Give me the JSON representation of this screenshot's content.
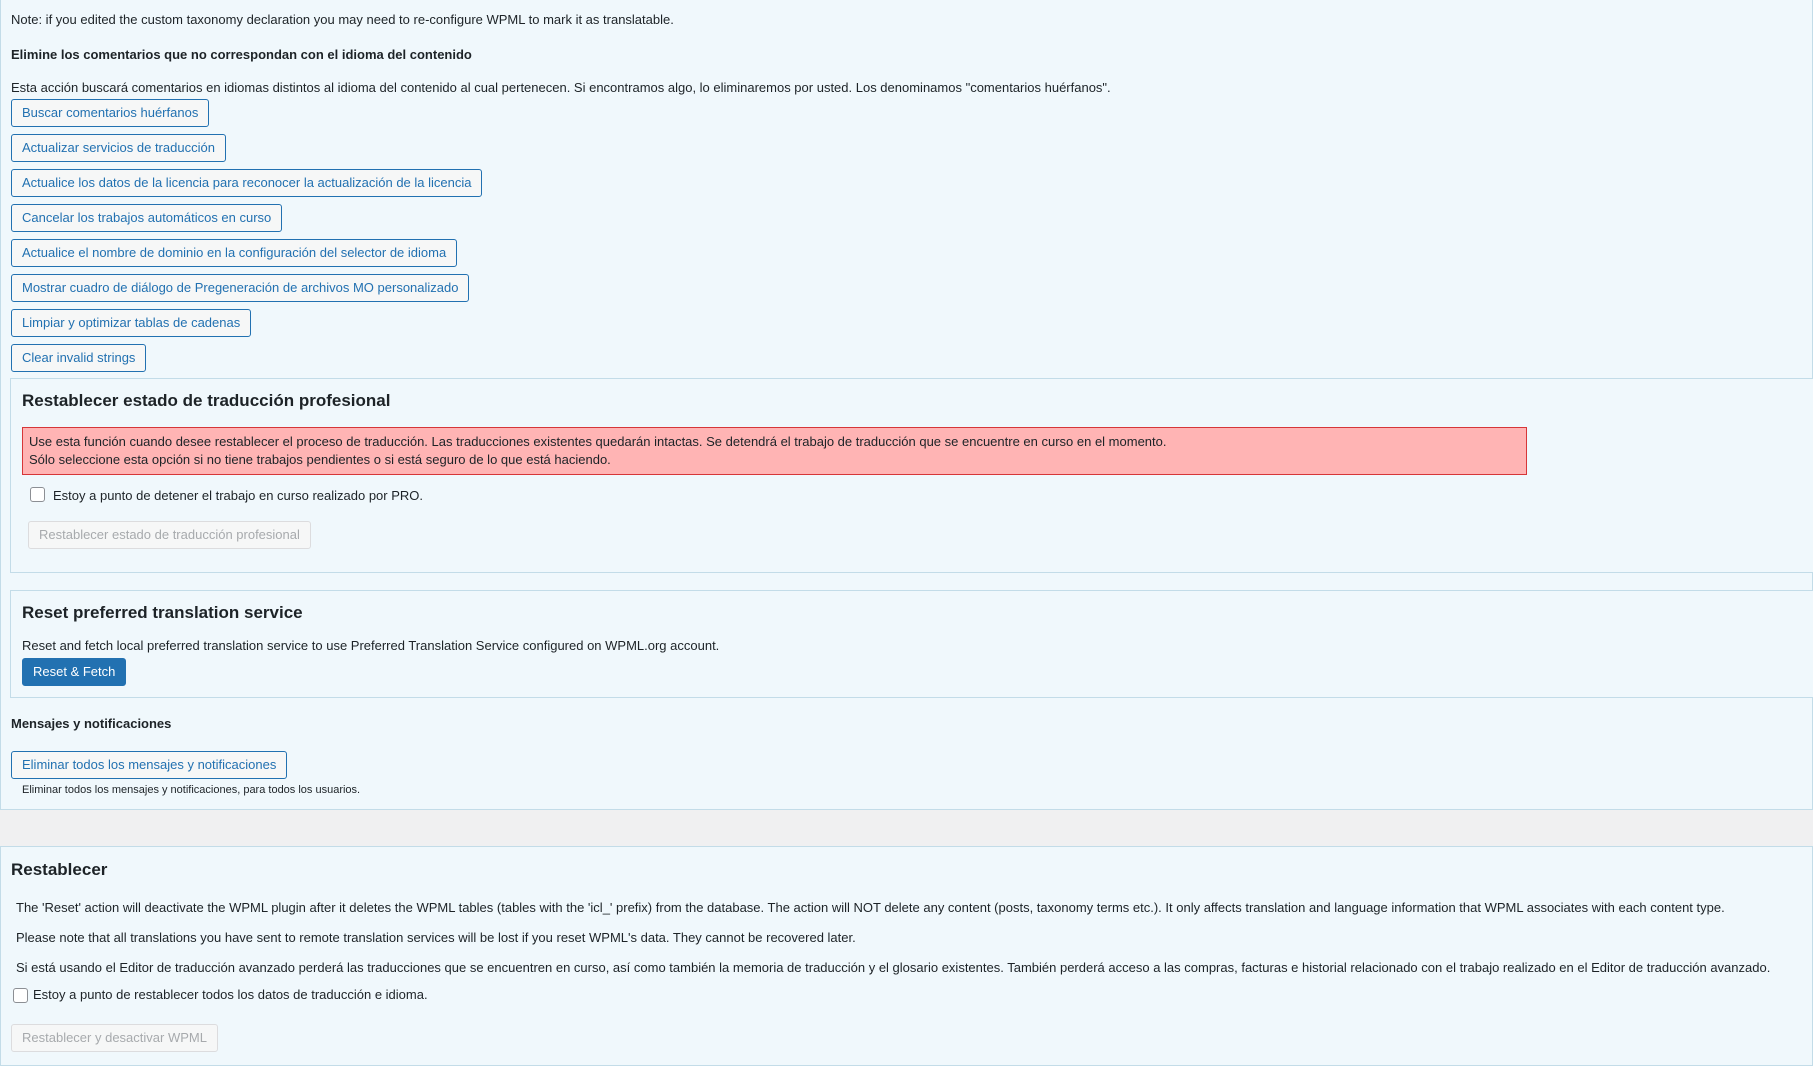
{
  "note": "Note: if you edited the custom taxonomy declaration you may need to re-configure WPML to mark it as translatable.",
  "orphans": {
    "heading": "Elimine los comentarios que no correspondan con el idioma del contenido",
    "description": "Esta acción buscará comentarios en idiomas distintos al idioma del contenido al cual pertenecen. Si encontramos algo, lo eliminaremos por usted. Los denominamos \"comentarios huérfanos\"."
  },
  "buttons": {
    "find_orphans": "Buscar comentarios huérfanos",
    "update_services": "Actualizar servicios de traducción",
    "update_license": "Actualice los datos de la licencia para reconocer la actualización de la licencia",
    "cancel_jobs": "Cancelar los trabajos automáticos en curso",
    "update_domain": "Actualice el nombre de dominio en la configuración del selector de idioma",
    "show_mo_dialog": "Mostrar cuadro de diálogo de Pregeneración de archivos MO personalizado",
    "clean_strings": "Limpiar y optimizar tablas de cadenas",
    "clear_invalid": "Clear invalid strings"
  },
  "pro_reset": {
    "title": "Restablecer estado de traducción profesional",
    "warning_line1": "Use esta función cuando desee restablecer el proceso de traducción. Las traducciones existentes quedarán intactas. Se detendrá el trabajo de traducción que se encuentre en curso en el momento.",
    "warning_line2": "Sólo seleccione esta opción si no tiene trabajos pendientes o si está seguro de lo que está haciendo.",
    "checkbox_label": "Estoy a punto de detener el trabajo en curso realizado por PRO.",
    "button": "Restablecer estado de traducción profesional"
  },
  "preferred_service": {
    "title": "Reset preferred translation service",
    "description": "Reset and fetch local preferred translation service to use Preferred Translation Service configured on WPML.org account.",
    "button": "Reset & Fetch"
  },
  "messages": {
    "heading": "Mensajes y notificaciones",
    "button": "Eliminar todos los mensajes y notificaciones",
    "hint": "Eliminar todos los mensajes y notificaciones, para todos los usuarios."
  },
  "reset": {
    "title": "Restablecer",
    "p1": "The 'Reset' action will deactivate the WPML plugin after it deletes the WPML tables (tables with the 'icl_' prefix) from the database. The action will NOT delete any content (posts, taxonomy terms etc.). It only affects translation and language information that WPML associates with each content type.",
    "p2": "Please note that all translations you have sent to remote translation services will be lost if you reset WPML's data. They cannot be recovered later.",
    "p3": "Si está usando el Editor de traducción avanzado perderá las traducciones que se encuentren en curso, así como también la memoria de traducción y el glosario existentes. También perderá acceso a las compras, facturas e historial relacionado con el trabajo realizado en el Editor de traducción avanzado.",
    "checkbox_label": "Estoy a punto de restablecer todos los datos de traducción e idioma.",
    "button": "Restablecer y desactivar WPML"
  }
}
